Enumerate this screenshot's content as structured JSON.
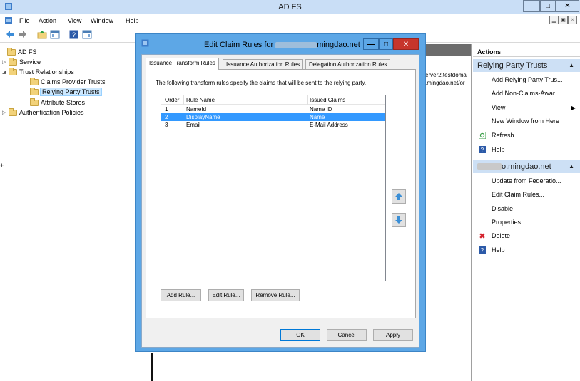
{
  "window": {
    "title": "AD FS",
    "minimize": "—",
    "maximize": "□",
    "close": "✕"
  },
  "menu": {
    "items": [
      "File",
      "Action",
      "View",
      "Window",
      "Help"
    ]
  },
  "tree": {
    "root": "AD FS",
    "items": [
      {
        "label": "Service"
      },
      {
        "label": "Trust Relationships"
      },
      {
        "label": "Claims Provider Trusts"
      },
      {
        "label": "Relying Party Trusts"
      },
      {
        "label": "Attribute Stores"
      },
      {
        "label": "Authentication Policies"
      }
    ]
  },
  "center": {
    "row1": "erver2.testdoma",
    "row2": ".mingdao.net/or"
  },
  "actions": {
    "header": "Actions",
    "section1": "Relying Party Trusts",
    "section1_items": [
      "Add Relying Party Trus...",
      "Add Non-Claims-Awar...",
      "View",
      "New Window from Here",
      "Refresh",
      "Help"
    ],
    "section2": "o.mingdao.net",
    "section2_items": [
      "Update from Federatio...",
      "Edit Claim Rules...",
      "Disable",
      "Properties",
      "Delete",
      "Help"
    ]
  },
  "dialog": {
    "title_prefix": "Edit Claim Rules for",
    "title_suffix": "mingdao.net",
    "minimize": "—",
    "maximize": "□",
    "close": "✕",
    "tabs": [
      "Issuance Transform Rules",
      "Issuance Authorization Rules",
      "Delegation Authorization Rules"
    ],
    "description": "The following transform rules specify the claims that will be sent to the relying party.",
    "columns": [
      "Order",
      "Rule Name",
      "Issued Claims"
    ],
    "rules": [
      {
        "order": "1",
        "name": "NameId",
        "claims": "Name ID"
      },
      {
        "order": "2",
        "name": "DisplayName",
        "claims": "Name"
      },
      {
        "order": "3",
        "name": "Email",
        "claims": "E-Mail Address"
      }
    ],
    "selected_rule": "2",
    "add_rule": "Add Rule...",
    "edit_rule": "Edit Rule...",
    "remove_rule": "Remove Rule...",
    "ok": "OK",
    "cancel": "Cancel",
    "apply": "Apply"
  }
}
